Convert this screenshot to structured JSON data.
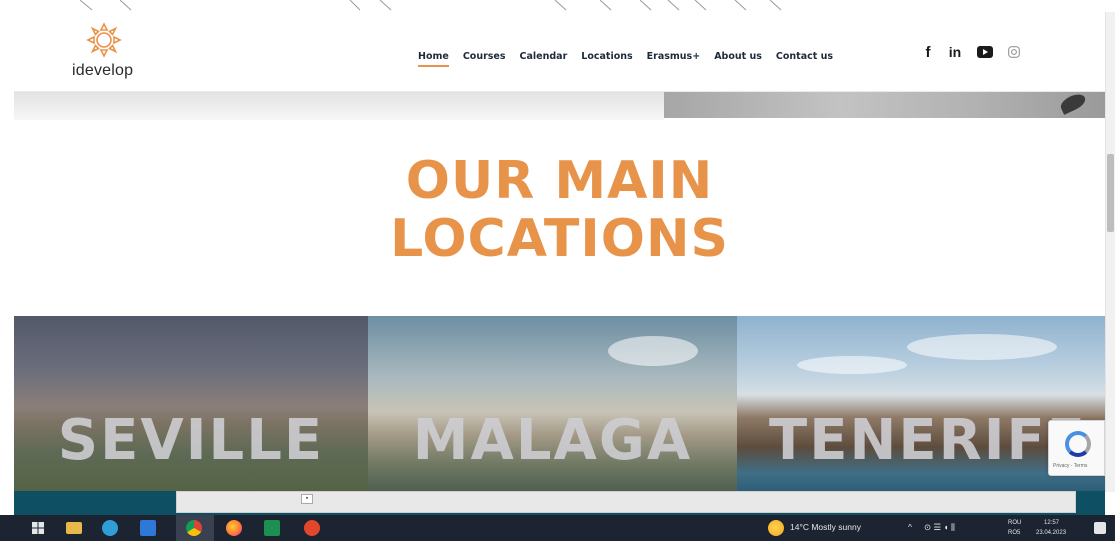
{
  "brand": {
    "name": "idevelop",
    "accent": "#e8934a"
  },
  "nav": {
    "items": [
      {
        "label": "Home",
        "active": true
      },
      {
        "label": "Courses",
        "active": false
      },
      {
        "label": "Calendar",
        "active": false
      },
      {
        "label": "Locations",
        "active": false
      },
      {
        "label": "Erasmus+",
        "active": false
      },
      {
        "label": "About us",
        "active": false
      },
      {
        "label": "Contact us",
        "active": false
      }
    ]
  },
  "social": [
    {
      "icon": "facebook-icon",
      "glyph": "f"
    },
    {
      "icon": "linkedin-icon",
      "glyph": "in"
    },
    {
      "icon": "youtube-icon",
      "glyph": "▶"
    },
    {
      "icon": "instagram-icon",
      "glyph": "◎"
    }
  ],
  "heading": {
    "line1": "OUR MAIN",
    "line2": "LOCATIONS"
  },
  "locations": [
    {
      "name": "SEVILLE"
    },
    {
      "name": "MALAGA"
    },
    {
      "name": "TENERIFE"
    }
  ],
  "taskbar": {
    "apps": [
      "windows-start-icon",
      "file-explorer-icon",
      "edge-icon",
      "mail-icon",
      "chrome-icon",
      "firefox-icon",
      "excel-icon",
      "pdf-icon"
    ],
    "weather": "14°C  Mostly sunny",
    "language": "ROU",
    "language_sub": "RO5",
    "time": "12:57",
    "date": "23.04.2023"
  }
}
